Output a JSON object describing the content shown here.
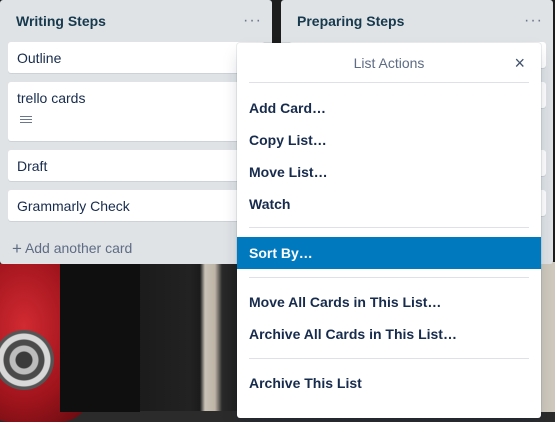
{
  "lists": [
    {
      "title": "Writing Steps",
      "menu": "···",
      "cards": [
        {
          "text": "Outline"
        },
        {
          "text": "trello cards",
          "has_description": true
        },
        {
          "text": "Draft"
        },
        {
          "text": "Grammarly Check"
        }
      ],
      "add_card": "Add another card"
    },
    {
      "title": "Preparing Steps",
      "menu": "···"
    }
  ],
  "popover": {
    "title": "List Actions",
    "close": "×",
    "items": [
      "Add Card…",
      "Copy List…",
      "Move List…",
      "Watch",
      "Sort By…",
      "Move All Cards in This List…",
      "Archive All Cards in This List…",
      "Archive This List"
    ],
    "active_item": "Sort By…"
  },
  "colors": {
    "list_bg": "#dfe3e6",
    "title_color": "#17394d",
    "active_bg": "#0079bf"
  }
}
